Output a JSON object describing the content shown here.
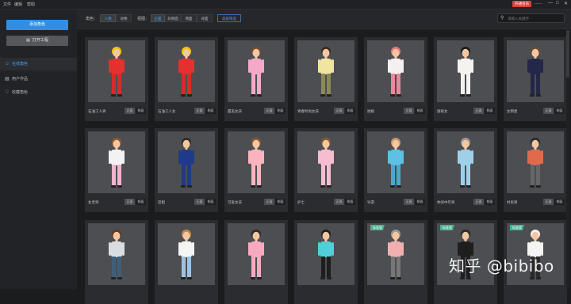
{
  "menubar": {
    "items": [
      "文件",
      "编辑",
      "帮助"
    ],
    "user_badge": "开通会员",
    "username": "‒‒‒‒",
    "window_buttons": [
      "—",
      "□",
      "✕"
    ]
  },
  "sidebar": {
    "add_role": "添加角色",
    "open_project": "打开工程",
    "nav": [
      {
        "label": "在线角色",
        "icon": "person-icon",
        "active": true
      },
      {
        "label": "用户作品",
        "icon": "folder-icon",
        "active": false
      },
      {
        "label": "收藏角色",
        "icon": "heart-icon",
        "active": false
      }
    ]
  },
  "toolbar": {
    "role_label": "角色：",
    "role_options": [
      {
        "label": "人物",
        "on": true
      },
      {
        "label": "动物",
        "on": false
      }
    ],
    "angle_label": "视图：",
    "angle_options": [
      {
        "label": "正面",
        "on": true
      },
      {
        "label": "斜侧面",
        "on": false
      },
      {
        "label": "侧面",
        "on": false
      },
      {
        "label": "背面",
        "on": false
      }
    ],
    "filter_label": "高级筛选",
    "search_placeholder": "请输入关键字"
  },
  "cards": [
    {
      "name": "石油工人男",
      "btn1": "正面",
      "btn2": "侧面",
      "tag": "",
      "hair": "#f2c400",
      "top": "#e53030",
      "bottom": "#d82a2a",
      "skin": "#f4c7a1"
    },
    {
      "name": "石油工人女",
      "btn1": "正面",
      "btn2": "侧面",
      "tag": "",
      "hair": "#f2c400",
      "top": "#e53030",
      "bottom": "#d82a2a",
      "skin": "#f4c7a1"
    },
    {
      "name": "甜美女孩",
      "btn1": "正面",
      "btn2": "侧面",
      "tag": "",
      "hair": "#7a4a2a",
      "top": "#f3a9c8",
      "bottom": "#f3a9c8",
      "skin": "#f4c7a1"
    },
    {
      "name": "青春时尚女孩",
      "btn1": "正面",
      "btn2": "侧面",
      "tag": "",
      "hair": "#3b2a20",
      "top": "#efe4a0",
      "bottom": "#8a8a55",
      "skin": "#f4c7a1"
    },
    {
      "name": "厨娘",
      "btn1": "正面",
      "btn2": "侧面",
      "tag": "",
      "hair": "#e9777f",
      "top": "#f4f0f0",
      "bottom": "#e48a9a",
      "skin": "#f4c7a1"
    },
    {
      "name": "旗袍女",
      "btn1": "正面",
      "btn2": "侧面",
      "tag": "",
      "hair": "#1b1b1b",
      "top": "#f5f3ef",
      "bottom": "#f5f3ef",
      "skin": "#f4c7a1"
    },
    {
      "name": "女明星",
      "btn1": "正面",
      "btn2": "侧面",
      "tag": "",
      "hair": "#6b4a2e",
      "top": "#232848",
      "bottom": "#232848",
      "skin": "#f4c7a1"
    },
    {
      "name": "女老师",
      "btn1": "正面",
      "btn2": "侧面",
      "tag": "",
      "hair": "#8a5a30",
      "top": "#f2f2f2",
      "bottom": "#f7b2cf",
      "skin": "#f4c7a1"
    },
    {
      "name": "空姐",
      "btn1": "正面",
      "btn2": "侧面",
      "tag": "",
      "hair": "#2c2c2c",
      "top": "#1f3a8a",
      "bottom": "#1f3a8a",
      "skin": "#f4c7a1"
    },
    {
      "name": "可爱女孩",
      "btn1": "正面",
      "btn2": "侧面",
      "tag": "",
      "hair": "#8a5a30",
      "top": "#f9b4c0",
      "bottom": "#f9b4c0",
      "skin": "#f4c7a1"
    },
    {
      "name": "护士",
      "btn1": "正面",
      "btn2": "侧面",
      "tag": "",
      "hair": "#8a5a30",
      "top": "#f6bdd0",
      "bottom": "#f6bdd0",
      "skin": "#f4c7a1"
    },
    {
      "name": "导游",
      "btn1": "正面",
      "btn2": "侧面",
      "tag": "",
      "hair": "#c49a6c",
      "top": "#5fc0e6",
      "bottom": "#4aa8d0",
      "skin": "#f4c7a1"
    },
    {
      "name": "休闲中年男",
      "btn1": "正面",
      "btn2": "侧面",
      "tag": "",
      "hair": "#9a9a9a",
      "top": "#9fd0ea",
      "bottom": "#9fd0ea",
      "skin": "#f4c7a1"
    },
    {
      "name": "村民男",
      "btn1": "正面",
      "btn2": "侧面",
      "tag": "",
      "hair": "#2a2a2a",
      "top": "#e26a4c",
      "bottom": "#666666",
      "skin": "#f4c7a1"
    },
    {
      "name": "",
      "btn1": "",
      "btn2": "",
      "tag": "",
      "hair": "#5a3a22",
      "top": "#d9dde2",
      "bottom": "#3f5e7a",
      "skin": "#f4c7a1"
    },
    {
      "name": "",
      "btn1": "",
      "btn2": "",
      "tag": "",
      "hair": "#c48a40",
      "top": "#f4f4f4",
      "bottom": "#9fc2e2",
      "skin": "#f4c7a1"
    },
    {
      "name": "",
      "btn1": "",
      "btn2": "",
      "tag": "",
      "hair": "#2a2a2a",
      "top": "#f7a9c0",
      "bottom": "#f7a9c0",
      "skin": "#f4c7a1"
    },
    {
      "name": "",
      "btn1": "",
      "btn2": "",
      "tag": "",
      "hair": "#1e1e1e",
      "top": "#4fd0d8",
      "bottom": "#1e1e1e",
      "skin": "#f4c7a1"
    },
    {
      "name": "",
      "btn1": "",
      "btn2": "",
      "tag": "标准版",
      "hair": "#9a9a9a",
      "top": "#f0b0b0",
      "bottom": "#777777",
      "skin": "#f4c7a1"
    },
    {
      "name": "",
      "btn1": "",
      "btn2": "",
      "tag": "标准版",
      "hair": "#2a2a2a",
      "top": "#1e1e1e",
      "bottom": "#1e1e1e",
      "skin": "#f4c7a1"
    },
    {
      "name": "",
      "btn1": "",
      "btn2": "",
      "tag": "标准版",
      "hair": "#f2f2f2",
      "top": "#f4f4f4",
      "bottom": "#2a2a2a",
      "skin": "#f4c7a1"
    }
  ],
  "watermark": "知乎 @bibibo"
}
